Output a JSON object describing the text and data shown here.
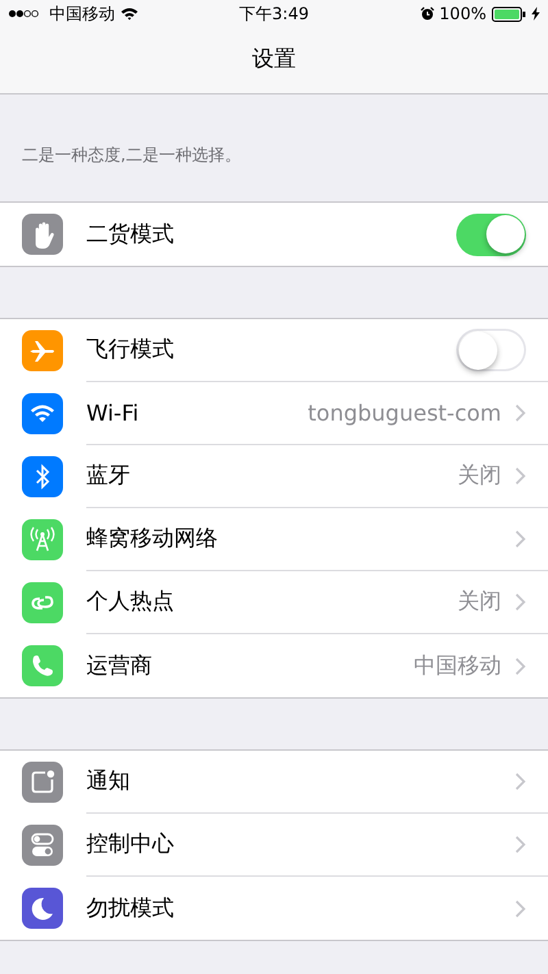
{
  "status_bar": {
    "carrier": "中国移动",
    "time": "下午3:49",
    "battery": "100%"
  },
  "nav": {
    "title": "设置"
  },
  "note": "二是一种态度,二是一种选择。",
  "groups": [
    {
      "rows": [
        {
          "kind": "toggle",
          "label": "二货模式",
          "on": true
        }
      ]
    },
    {
      "rows": [
        {
          "kind": "toggle",
          "label": "飞行模式",
          "on": false
        },
        {
          "kind": "detail",
          "label": "Wi-Fi",
          "value": "tongbuguest-com"
        },
        {
          "kind": "detail",
          "label": "蓝牙",
          "value": "关闭"
        },
        {
          "kind": "detail",
          "label": "蜂窝移动网络"
        },
        {
          "kind": "detail",
          "label": "个人热点",
          "value": "关闭"
        },
        {
          "kind": "detail",
          "label": "运营商",
          "value": "中国移动"
        }
      ]
    },
    {
      "rows": [
        {
          "kind": "detail",
          "label": "通知"
        },
        {
          "kind": "detail",
          "label": "控制中心"
        },
        {
          "kind": "detail",
          "label": "勿扰模式"
        }
      ]
    }
  ]
}
